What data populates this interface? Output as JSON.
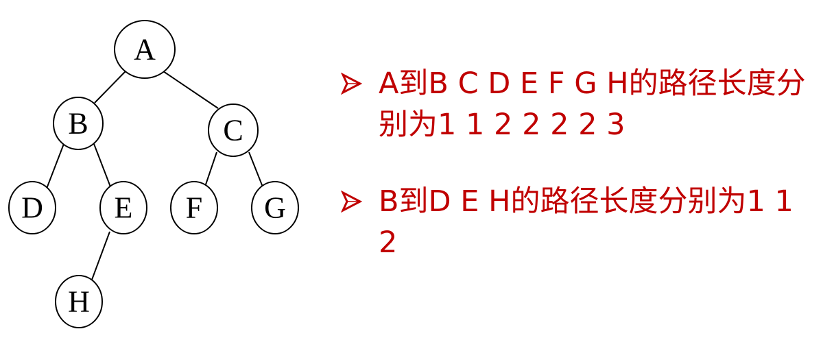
{
  "tree": {
    "nodes": [
      {
        "id": "A",
        "label": "A"
      },
      {
        "id": "B",
        "label": "B"
      },
      {
        "id": "C",
        "label": "C"
      },
      {
        "id": "D",
        "label": "D"
      },
      {
        "id": "E",
        "label": "E"
      },
      {
        "id": "F",
        "label": "F"
      },
      {
        "id": "G",
        "label": "G"
      },
      {
        "id": "H",
        "label": "H"
      }
    ],
    "edges": [
      [
        "A",
        "B"
      ],
      [
        "A",
        "C"
      ],
      [
        "B",
        "D"
      ],
      [
        "B",
        "E"
      ],
      [
        "C",
        "F"
      ],
      [
        "C",
        "G"
      ],
      [
        "E",
        "H"
      ]
    ]
  },
  "bullets": {
    "marker_icon": "arrowhead-bullet-icon",
    "color": "#c00000",
    "items": [
      {
        "text": "A到B C D E F G H的路径长度分别为1 1 2 2 2 2 3"
      },
      {
        "text": "B到D E H的路径长度分别为1 1 2"
      }
    ]
  }
}
